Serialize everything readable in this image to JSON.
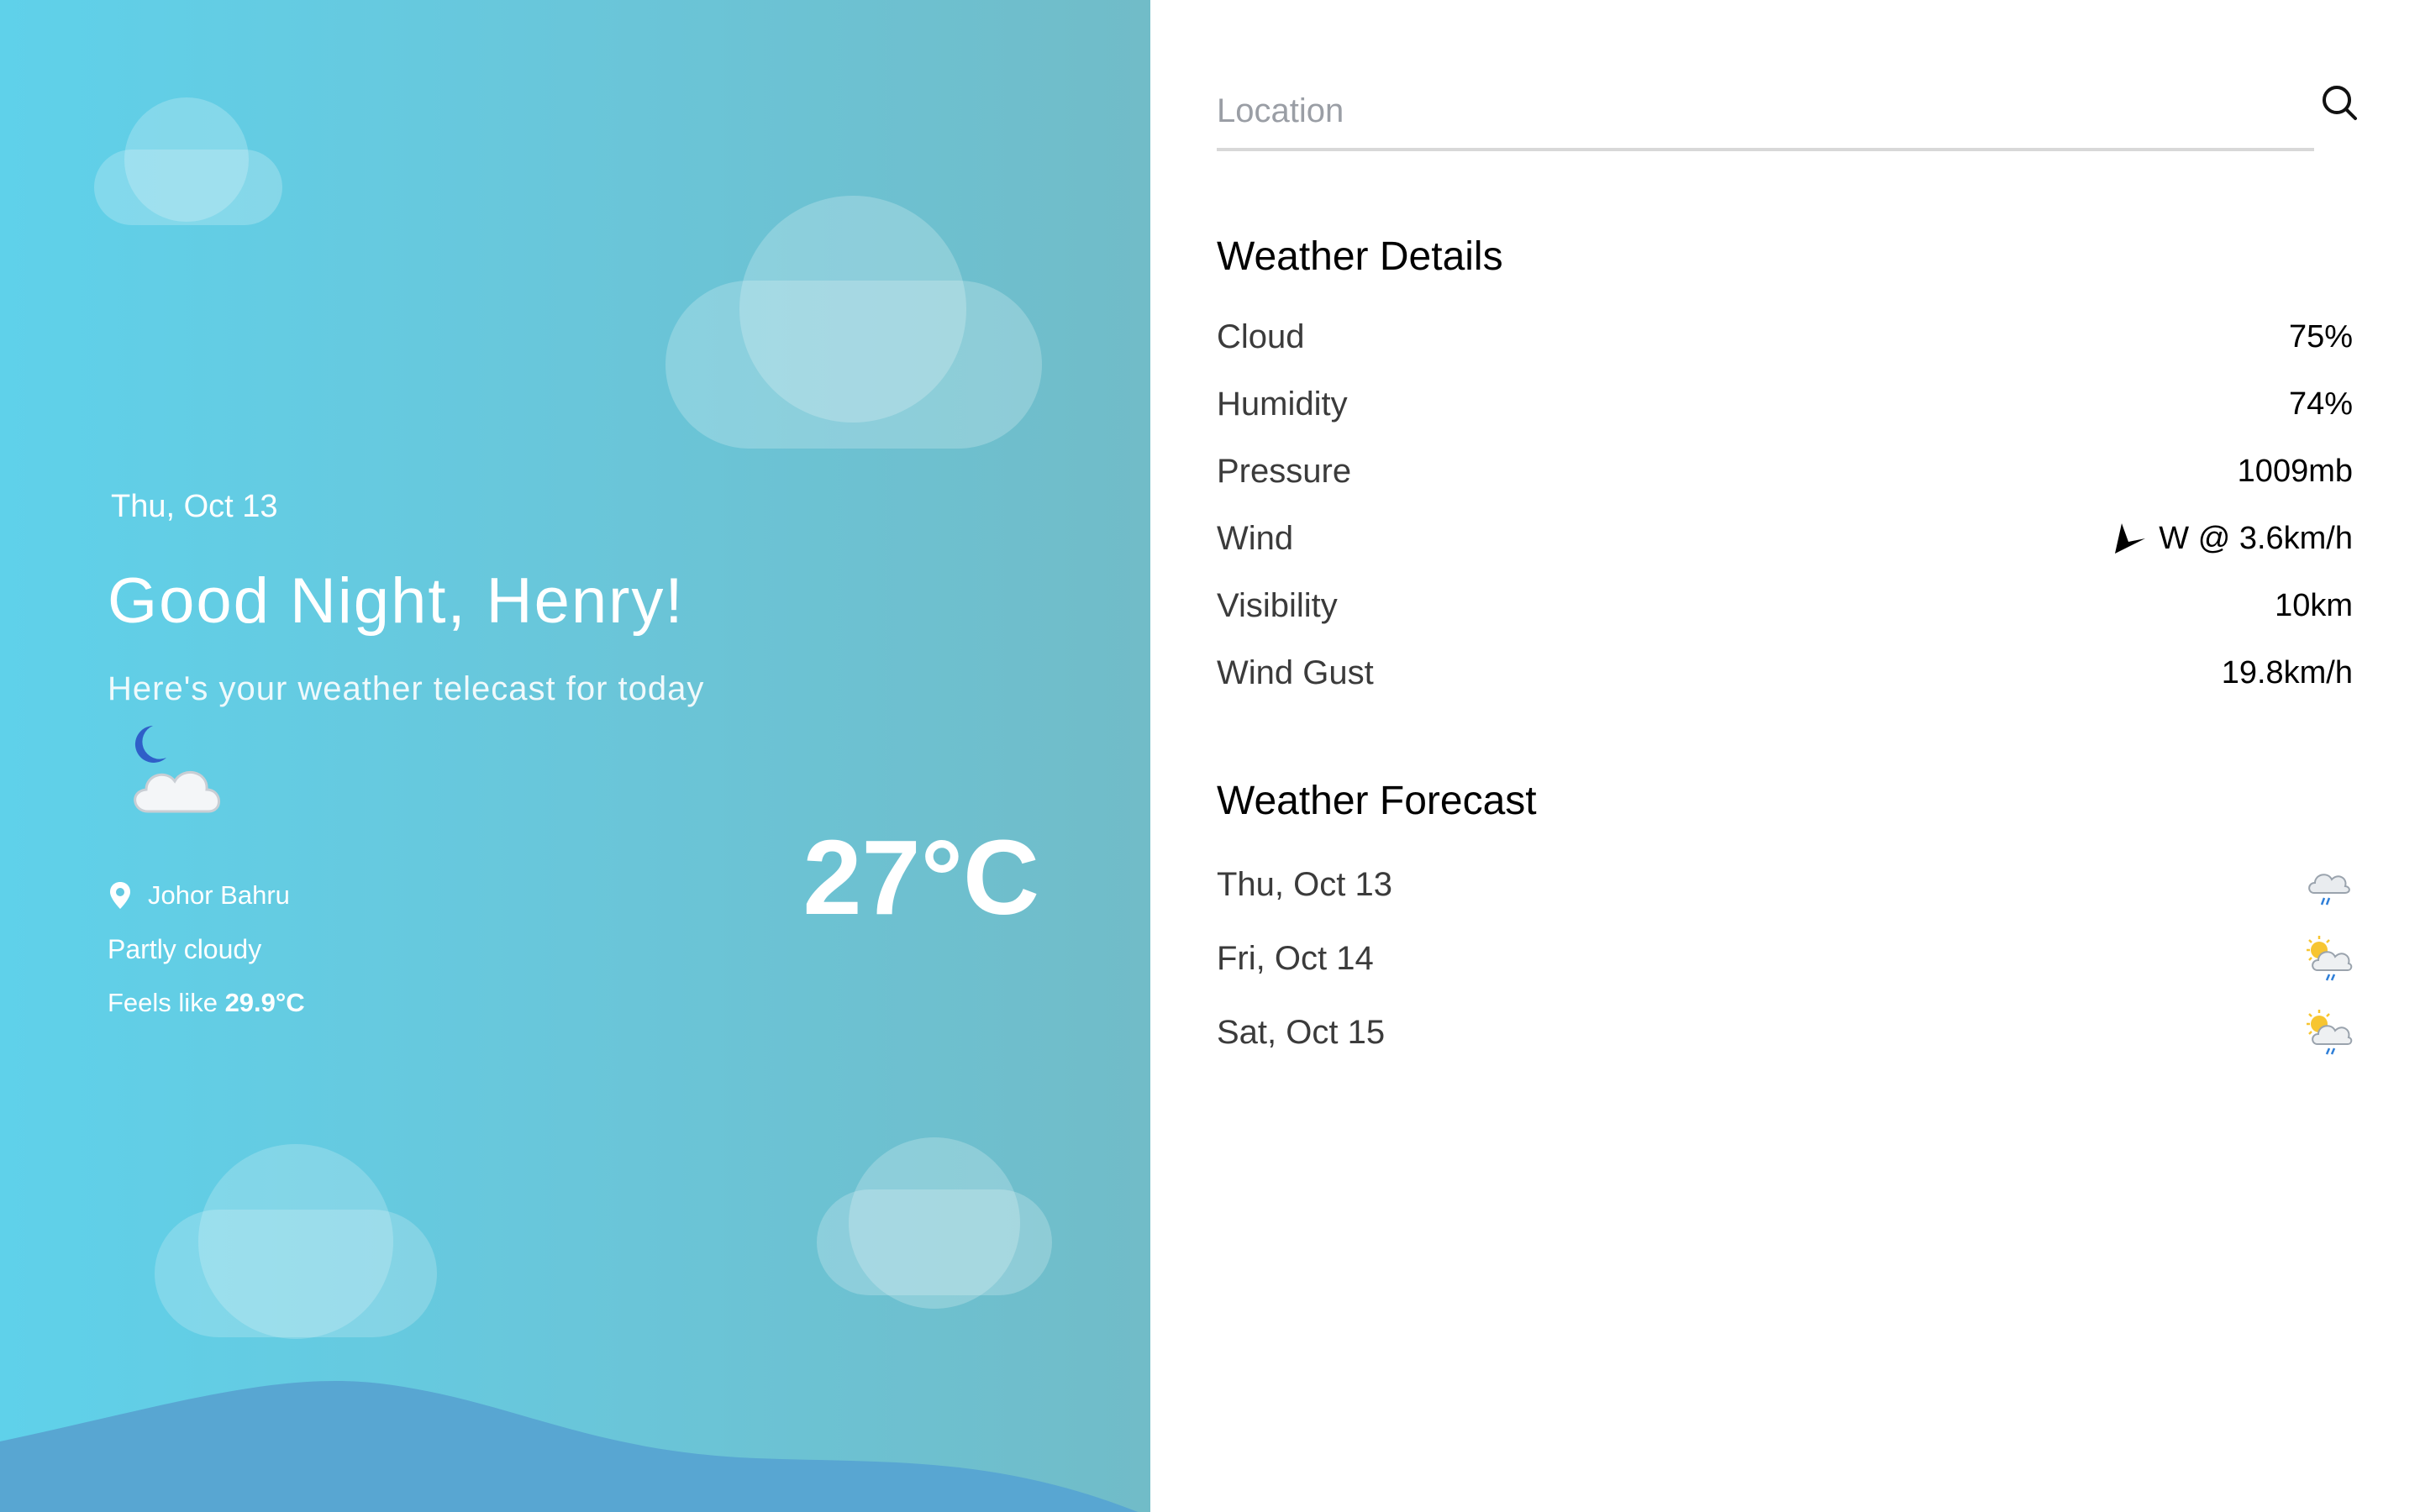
{
  "hero": {
    "date": "Thu, Oct 13",
    "greeting": "Good Night, Henry!",
    "subtitle": "Here's your weather telecast for today",
    "weather_icon": "night-partly-cloudy-icon",
    "location": "Johor Bahru",
    "condition": "Partly cloudy",
    "feels_like_label": "Feels like",
    "feels_like_value": "29.9°C",
    "temperature": "27°C"
  },
  "search": {
    "placeholder": "Location",
    "value": "",
    "icon": "search-icon"
  },
  "details": {
    "title": "Weather Details",
    "items": [
      {
        "label": "Cloud",
        "value": "75%"
      },
      {
        "label": "Humidity",
        "value": "74%"
      },
      {
        "label": "Pressure",
        "value": "1009mb"
      },
      {
        "label": "Wind",
        "value": "W @ 3.6km/h",
        "icon": "wind-direction-arrow-icon"
      },
      {
        "label": "Visibility",
        "value": "10km"
      },
      {
        "label": "Wind Gust",
        "value": "19.8km/h"
      }
    ]
  },
  "forecast": {
    "title": "Weather Forecast",
    "days": [
      {
        "day": "Thu, Oct 13",
        "icon": "rain-cloud-icon"
      },
      {
        "day": "Fri, Oct 14",
        "icon": "sun-rain-cloud-icon"
      },
      {
        "day": "Sat, Oct 15",
        "icon": "sun-rain-cloud-icon"
      }
    ]
  },
  "colors": {
    "hero_gradient_start": "#5fd1ea",
    "hero_gradient_end": "#71bcc8",
    "wave": "#58a6d2",
    "cloud": "#9fdcea"
  }
}
